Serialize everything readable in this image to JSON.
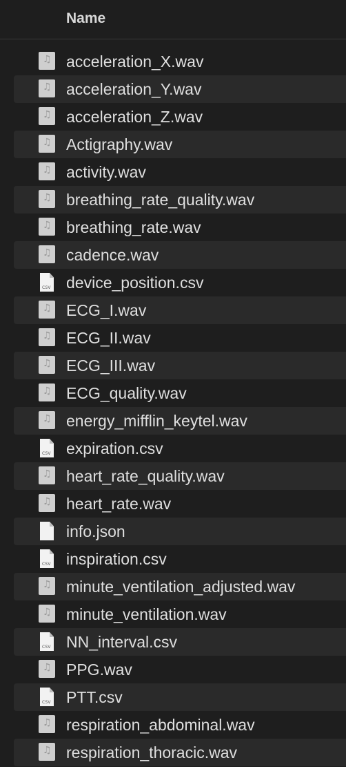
{
  "header": {
    "name_label": "Name"
  },
  "icons": {
    "audio": "audio-file-icon",
    "csv": "csv-file-icon",
    "json": "generic-file-icon"
  },
  "files": [
    {
      "name": "acceleration_X.wav",
      "type": "audio"
    },
    {
      "name": "acceleration_Y.wav",
      "type": "audio"
    },
    {
      "name": "acceleration_Z.wav",
      "type": "audio"
    },
    {
      "name": "Actigraphy.wav",
      "type": "audio"
    },
    {
      "name": "activity.wav",
      "type": "audio"
    },
    {
      "name": "breathing_rate_quality.wav",
      "type": "audio"
    },
    {
      "name": "breathing_rate.wav",
      "type": "audio"
    },
    {
      "name": "cadence.wav",
      "type": "audio"
    },
    {
      "name": "device_position.csv",
      "type": "csv",
      "tag": "CSV"
    },
    {
      "name": "ECG_I.wav",
      "type": "audio"
    },
    {
      "name": "ECG_II.wav",
      "type": "audio"
    },
    {
      "name": "ECG_III.wav",
      "type": "audio"
    },
    {
      "name": "ECG_quality.wav",
      "type": "audio"
    },
    {
      "name": "energy_mifflin_keytel.wav",
      "type": "audio"
    },
    {
      "name": "expiration.csv",
      "type": "csv",
      "tag": "CSV"
    },
    {
      "name": "heart_rate_quality.wav",
      "type": "audio"
    },
    {
      "name": "heart_rate.wav",
      "type": "audio"
    },
    {
      "name": "info.json",
      "type": "json"
    },
    {
      "name": "inspiration.csv",
      "type": "csv",
      "tag": "CSV"
    },
    {
      "name": "minute_ventilation_adjusted.wav",
      "type": "audio"
    },
    {
      "name": "minute_ventilation.wav",
      "type": "audio"
    },
    {
      "name": "NN_interval.csv",
      "type": "csv",
      "tag": "CSV"
    },
    {
      "name": "PPG.wav",
      "type": "audio"
    },
    {
      "name": "PTT.csv",
      "type": "csv",
      "tag": "CSV"
    },
    {
      "name": "respiration_abdominal.wav",
      "type": "audio"
    },
    {
      "name": "respiration_thoracic.wav",
      "type": "audio"
    }
  ]
}
